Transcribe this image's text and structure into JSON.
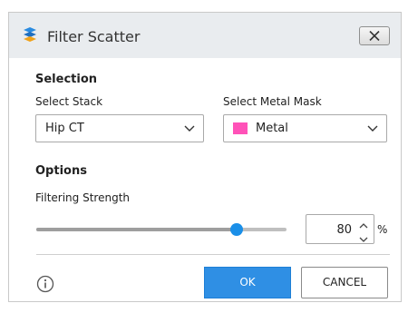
{
  "window": {
    "title": "Filter Scatter"
  },
  "selection": {
    "heading": "Selection",
    "stack_label": "Select Stack",
    "stack_value": "Hip CT",
    "mask_label": "Select Metal Mask",
    "mask_value": "Metal",
    "mask_color": "#ff52b8"
  },
  "options": {
    "heading": "Options",
    "strength_label": "Filtering Strength",
    "strength_value": "80",
    "strength_unit": "%",
    "slider_fraction": 0.8
  },
  "buttons": {
    "ok": "OK",
    "cancel": "CANCEL"
  },
  "colors": {
    "accent": "#2f8fe4",
    "slider_thumb": "#1a8fe8"
  },
  "icons": {
    "app": "app-logo-icon",
    "close": "close-icon",
    "dropdown": "chevron-down-icon",
    "spin_up": "chevron-up-icon",
    "spin_down": "chevron-down-icon",
    "info": "info-icon"
  }
}
